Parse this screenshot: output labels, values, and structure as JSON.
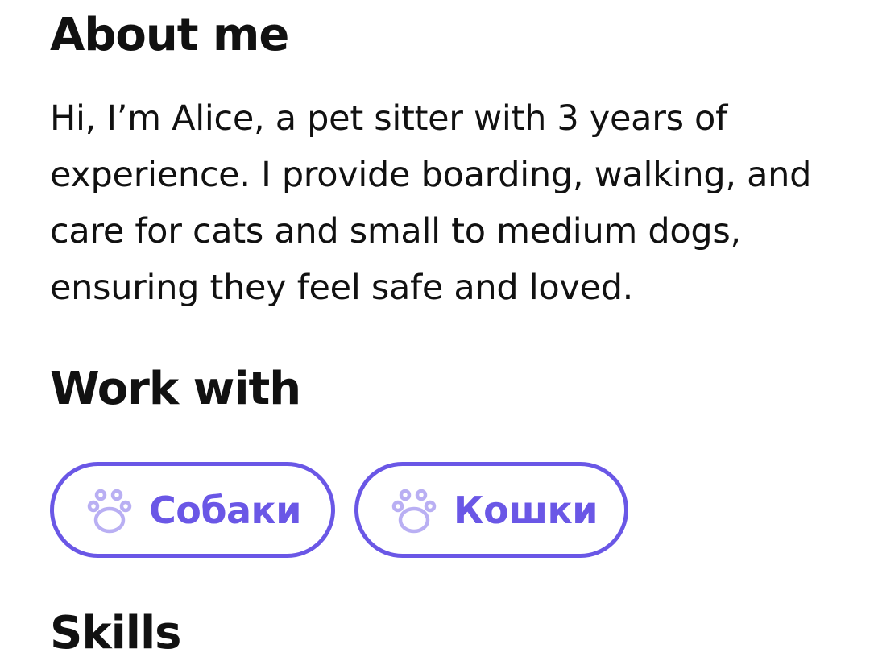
{
  "about": {
    "title": "About me",
    "text": "Hi, I’m Alice, a pet sitter with 3 years of experience. I provide boarding, walking, and care for cats and small to medium dogs, ensuring they feel safe and loved."
  },
  "work_with": {
    "title": "Work with",
    "chips": [
      {
        "label": "Собаки",
        "icon": "paw-icon"
      },
      {
        "label": "Кошки",
        "icon": "paw-icon"
      }
    ]
  },
  "skills": {
    "title": "Skills"
  },
  "colors": {
    "accent": "#6a57e6",
    "text": "#111111",
    "background": "#ffffff"
  }
}
